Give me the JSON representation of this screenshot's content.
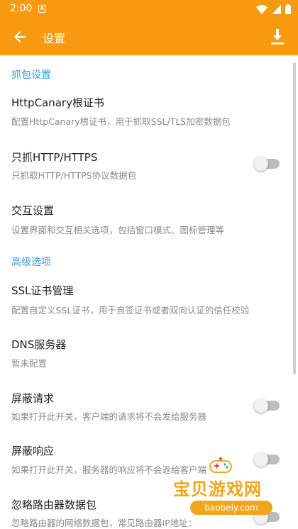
{
  "status_bar": {
    "time": "2:00",
    "notification_icon": "A"
  },
  "appbar": {
    "title": "设置",
    "back_icon": "arrow-left-icon",
    "action_icon": "download-icon"
  },
  "sections": [
    {
      "header": "抓包设置",
      "items": [
        {
          "title": "HttpCanary根证书",
          "subtitle": "配置HttpCanary根证书，用于抓取SSL/TLS加密数据包"
        },
        {
          "title": "只抓HTTP/HTTPS",
          "subtitle": "只抓取HTTP/HTTPS协议数据包",
          "toggle": false
        },
        {
          "title": "交互设置",
          "subtitle": "设置界面和交互相关选项，包括窗口模式、图标管理等"
        }
      ]
    },
    {
      "header": "高级选项",
      "items": [
        {
          "title": "SSL证书管理",
          "subtitle": "配置自定义SSL证书，用于自签证书或者双向认证的信任校验"
        },
        {
          "title": "DNS服务器",
          "subtitle": "暂未配置"
        },
        {
          "title": "屏蔽请求",
          "subtitle": "如果打开此开关，客户端的请求将不会发给服务器",
          "toggle": false
        },
        {
          "title": "屏蔽响应",
          "subtitle": "如果打开此开关，服务器的响应将不会返给客户端",
          "toggle": false
        },
        {
          "title": "忽略路由器数据包",
          "subtitle": "忽略路由器的网络数据包，常见路由器IP地址：",
          "toggle": false
        }
      ]
    }
  ],
  "watermark": {
    "brand": "宝贝游戏网",
    "url": "baobeiy.com"
  },
  "colors": {
    "primary": "#f79a10",
    "section_header": "#3a9ad9",
    "watermark": "#f0a51c"
  }
}
